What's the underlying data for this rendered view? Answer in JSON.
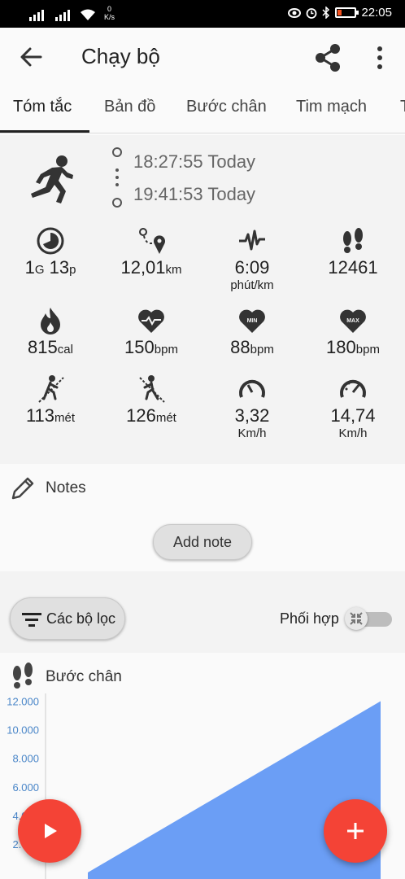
{
  "status_bar": {
    "net_speed_value": "0",
    "net_speed_unit": "K/s",
    "time": "22:05"
  },
  "header": {
    "title": "Chạy bộ"
  },
  "tabs": [
    "Tóm tắc",
    "Bản đồ",
    "Bước chân",
    "Tim mạch"
  ],
  "activity": {
    "start_time": "18:27:55 Today",
    "end_time": "19:41:53 Today"
  },
  "stats": {
    "duration": {
      "h": "1",
      "h_unit": "G",
      "m": "13",
      "m_unit": "p"
    },
    "distance": {
      "value": "12,01",
      "unit": "km"
    },
    "pace": {
      "value": "6:09",
      "unit": "phút/km"
    },
    "steps": {
      "value": "12461"
    },
    "calories": {
      "value": "815",
      "unit": "cal"
    },
    "avg_hr": {
      "value": "150",
      "unit": "bpm"
    },
    "min_hr": {
      "value": "88",
      "unit": "bpm",
      "badge": "MIN"
    },
    "max_hr": {
      "value": "180",
      "unit": "bpm",
      "badge": "MAX"
    },
    "ascent": {
      "value": "113",
      "unit": "mét"
    },
    "descent": {
      "value": "126",
      "unit": "mét"
    },
    "avg_speed": {
      "value": "3,32",
      "unit": "Km/h"
    },
    "max_speed": {
      "value": "14,74",
      "unit": "Km/h"
    }
  },
  "notes": {
    "title": "Notes",
    "add_label": "Add note"
  },
  "filters": {
    "button_label": "Các bộ lọc",
    "combine_label": "Phối hợp",
    "combine_on": false
  },
  "steps_section": {
    "title": "Bước chân"
  },
  "chart_data": {
    "type": "area",
    "x": [
      0,
      1
    ],
    "values": [
      0,
      12000
    ],
    "yticks": [
      "2.000",
      "4.000",
      "6.000",
      "8.000",
      "10.000",
      "12.000"
    ],
    "ylim": [
      0,
      13000
    ],
    "color": "#6b9ef5"
  },
  "colors": {
    "fab": "#f44336",
    "accent_axis": "#4a86c8"
  },
  "icons": {
    "back": "arrow-back-icon",
    "share": "share-icon",
    "more": "more-vert-icon",
    "play": "play-icon",
    "add": "add-icon"
  }
}
